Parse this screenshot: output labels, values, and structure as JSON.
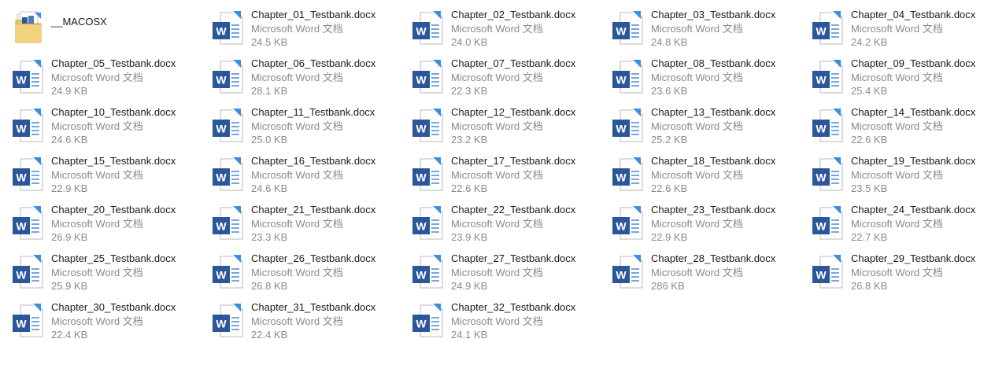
{
  "colors": {
    "word_blue": "#2b579a",
    "arrow_blue": "#3a8ee6",
    "folder_yellow": "#e8c46a",
    "name_text": "#1a1a1a",
    "meta_text": "#8a8a8a"
  },
  "folder": {
    "name": "__MACOSX",
    "icon": "folder-icon"
  },
  "file_type": "Microsoft Word 文档",
  "file_icon": "word-document-shortcut-icon",
  "files": [
    {
      "name": "Chapter_01_Testbank.docx",
      "size": "24.5 KB"
    },
    {
      "name": "Chapter_02_Testbank.docx",
      "size": "24.0 KB"
    },
    {
      "name": "Chapter_03_Testbank.docx",
      "size": "24.8 KB"
    },
    {
      "name": "Chapter_04_Testbank.docx",
      "size": "24.2 KB"
    },
    {
      "name": "Chapter_05_Testbank.docx",
      "size": "24.9 KB"
    },
    {
      "name": "Chapter_06_Testbank.docx",
      "size": "28.1 KB"
    },
    {
      "name": "Chapter_07_Testbank.docx",
      "size": "22.3 KB"
    },
    {
      "name": "Chapter_08_Testbank.docx",
      "size": "23.6 KB"
    },
    {
      "name": "Chapter_09_Testbank.docx",
      "size": "25.4 KB"
    },
    {
      "name": "Chapter_10_Testbank.docx",
      "size": "24.6 KB"
    },
    {
      "name": "Chapter_11_Testbank.docx",
      "size": "25.0 KB"
    },
    {
      "name": "Chapter_12_Testbank.docx",
      "size": "23.2 KB"
    },
    {
      "name": "Chapter_13_Testbank.docx",
      "size": "25.2 KB"
    },
    {
      "name": "Chapter_14_Testbank.docx",
      "size": "22.6 KB"
    },
    {
      "name": "Chapter_15_Testbank.docx",
      "size": "22.9 KB"
    },
    {
      "name": "Chapter_16_Testbank.docx",
      "size": "24.6 KB"
    },
    {
      "name": "Chapter_17_Testbank.docx",
      "size": "22.6 KB"
    },
    {
      "name": "Chapter_18_Testbank.docx",
      "size": "22.6 KB"
    },
    {
      "name": "Chapter_19_Testbank.docx",
      "size": "23.5 KB"
    },
    {
      "name": "Chapter_20_Testbank.docx",
      "size": "26.9 KB"
    },
    {
      "name": "Chapter_21_Testbank.docx",
      "size": "23.3 KB"
    },
    {
      "name": "Chapter_22_Testbank.docx",
      "size": "23.9 KB"
    },
    {
      "name": "Chapter_23_Testbank.docx",
      "size": "22.9 KB"
    },
    {
      "name": "Chapter_24_Testbank.docx",
      "size": "22.7 KB"
    },
    {
      "name": "Chapter_25_Testbank.docx",
      "size": "25.9 KB"
    },
    {
      "name": "Chapter_26_Testbank.docx",
      "size": "26.8 KB"
    },
    {
      "name": "Chapter_27_Testbank.docx",
      "size": "24.9 KB"
    },
    {
      "name": "Chapter_28_Testbank.docx",
      "size": "286 KB"
    },
    {
      "name": "Chapter_29_Testbank.docx",
      "size": "26.8 KB"
    },
    {
      "name": "Chapter_30_Testbank.docx",
      "size": "22.4 KB"
    },
    {
      "name": "Chapter_31_Testbank.docx",
      "size": "22.4 KB"
    },
    {
      "name": "Chapter_32_Testbank.docx",
      "size": "24.1 KB"
    }
  ]
}
